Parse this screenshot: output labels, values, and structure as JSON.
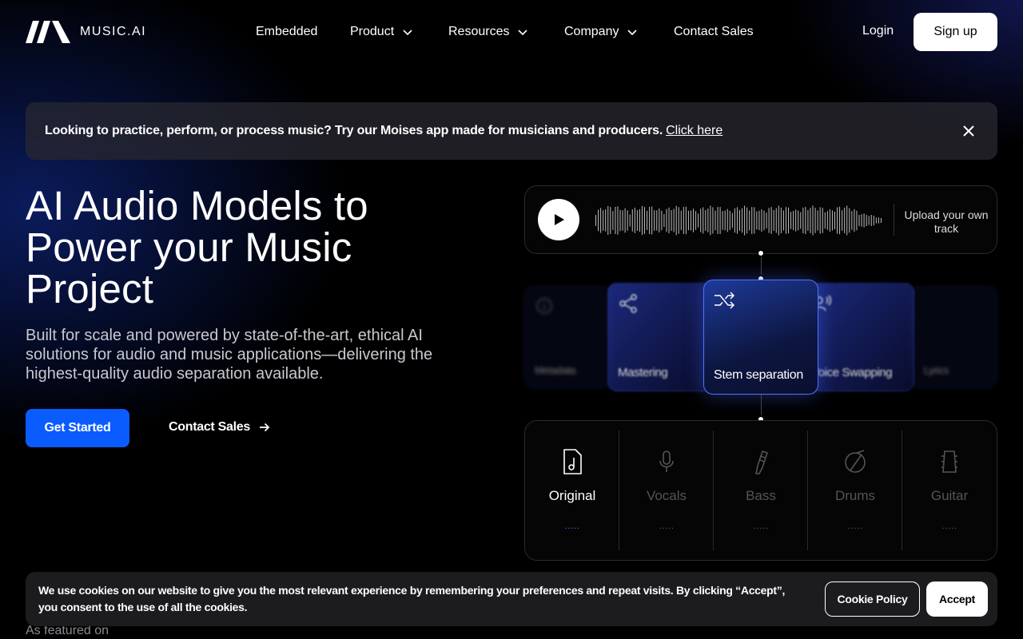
{
  "brand": {
    "name": "MUSIC.AI"
  },
  "nav": {
    "items": [
      {
        "label": "Embedded",
        "has_dropdown": false
      },
      {
        "label": "Product",
        "has_dropdown": true
      },
      {
        "label": "Resources",
        "has_dropdown": true
      },
      {
        "label": "Company",
        "has_dropdown": true
      },
      {
        "label": "Contact Sales",
        "has_dropdown": false
      }
    ],
    "login": "Login",
    "signup": "Sign up"
  },
  "banner": {
    "text": "Looking to practice, perform, or process music? Try our Moises app made for musicians and producers.",
    "link": "Click here"
  },
  "hero": {
    "title": "AI Audio Models to Power your Music Project",
    "subtitle": "Built for scale and powered by state-of-the-art, ethical AI solutions for audio and music applications—delivering the highest-quality audio separation available.",
    "primary_cta": "Get Started",
    "secondary_cta": "Contact Sales"
  },
  "player": {
    "upload_label": "Upload your own track"
  },
  "models": {
    "items": [
      {
        "label": "Metadata",
        "icon": "info-icon",
        "state": "far"
      },
      {
        "label": "Mastering",
        "icon": "share-nodes-icon",
        "state": "near"
      },
      {
        "label": "Stem separation",
        "icon": "split-arrows-icon",
        "state": "active"
      },
      {
        "label": "Voice Swapping",
        "icon": "voice-user-icon",
        "state": "near"
      },
      {
        "label": "Lyrics",
        "icon": "text-icon",
        "state": "far"
      }
    ]
  },
  "stems": {
    "items": [
      {
        "label": "Original",
        "icon": "music-file-icon",
        "active": true,
        "dots": "....."
      },
      {
        "label": "Vocals",
        "icon": "microphone-icon",
        "active": false,
        "dots": "....."
      },
      {
        "label": "Bass",
        "icon": "bass-guitar-icon",
        "active": false,
        "dots": "....."
      },
      {
        "label": "Drums",
        "icon": "drum-icon",
        "active": false,
        "dots": "....."
      },
      {
        "label": "Guitar",
        "icon": "guitar-headstock-icon",
        "active": false,
        "dots": "....."
      }
    ]
  },
  "cookie": {
    "text": "We use cookies on our website to give you the most relevant experience by remembering your preferences and repeat visits. By clicking “Accept”, you consent to the use of all the cookies.",
    "policy_button": "Cookie Policy",
    "accept_button": "Accept"
  },
  "featured_label": "As featured on",
  "colors": {
    "accent": "#0a5cff",
    "background": "#000000",
    "active_card_border": "#4f74ff"
  }
}
